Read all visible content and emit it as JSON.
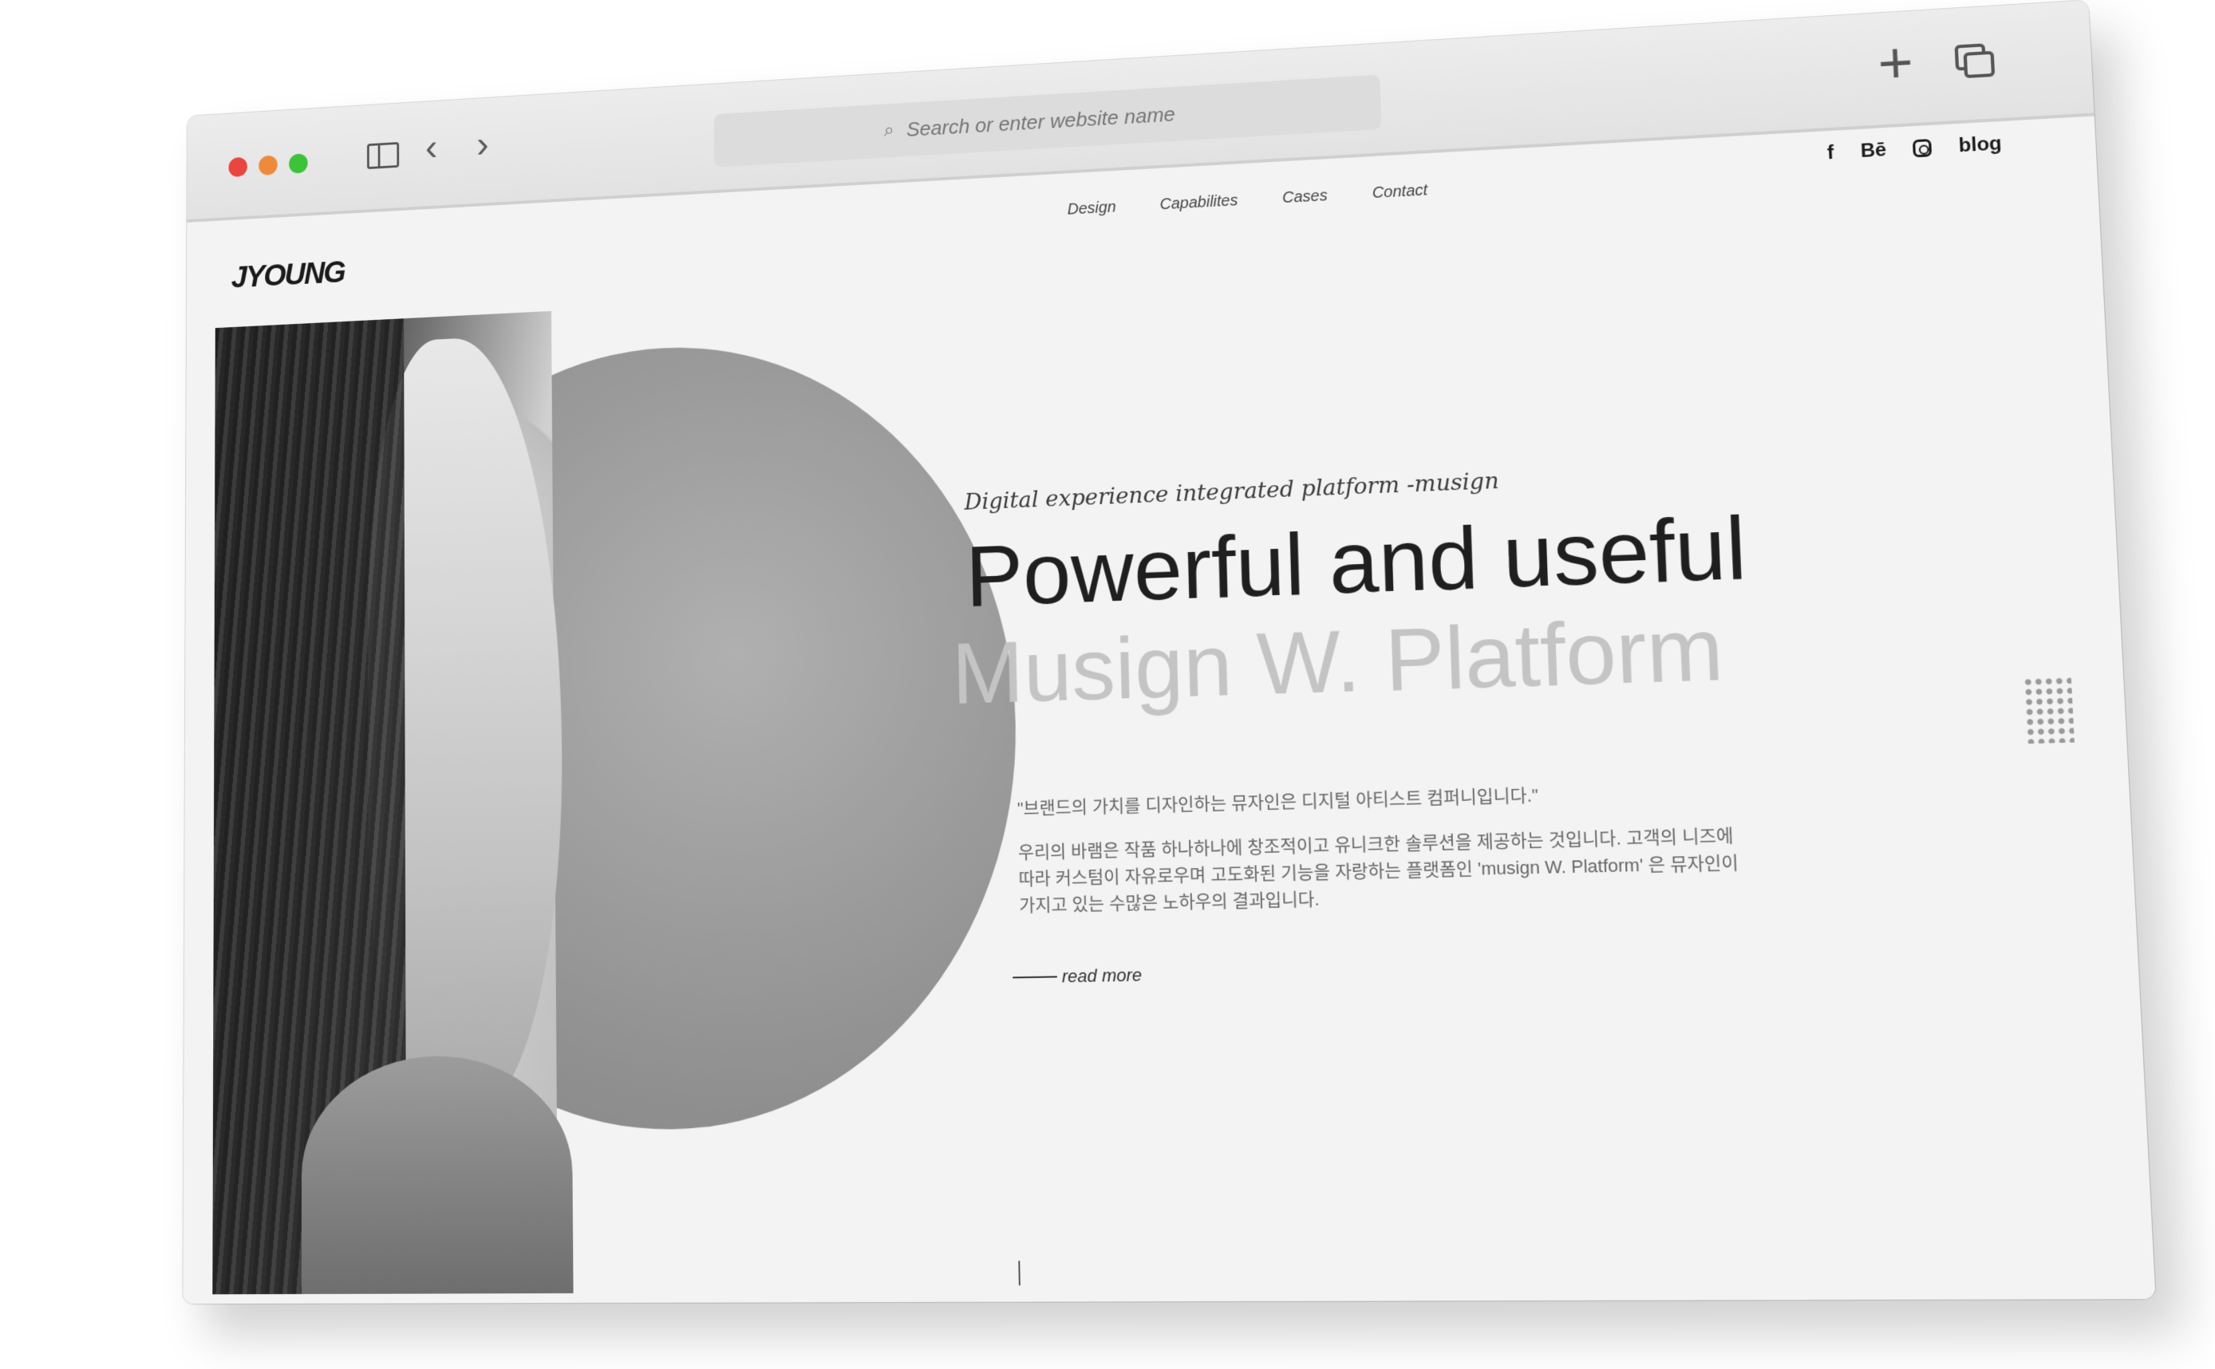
{
  "browser": {
    "address_placeholder": "Search or enter website name"
  },
  "site": {
    "logo": "JYOUNG",
    "nav": [
      "Design",
      "Capabilites",
      "Cases",
      "Contact"
    ],
    "social": {
      "facebook": "f",
      "behance": "Bē",
      "blog": "blog"
    }
  },
  "hero": {
    "tagline": "Digital experience integrated platform -musign",
    "headline_1": "Powerful and useful",
    "headline_2": "Musign W. Platform",
    "quote": "\"브랜드의 가치를 디자인하는 뮤자인은 디지털 아티스트 컴퍼니입니다.\"",
    "description": "우리의 바램은 작품 하나하나에 창조적이고 유니크한 솔루션을 제공하는 것입니다. 고객의 니즈에 따라 커스텀이 자유로우며 고도화된 기능을 자랑하는 플랫폼인 'musign W. Platform' 은 뮤자인이 가지고 있는 수많은 노하우의 결과입니다.",
    "read_more": "read more"
  }
}
